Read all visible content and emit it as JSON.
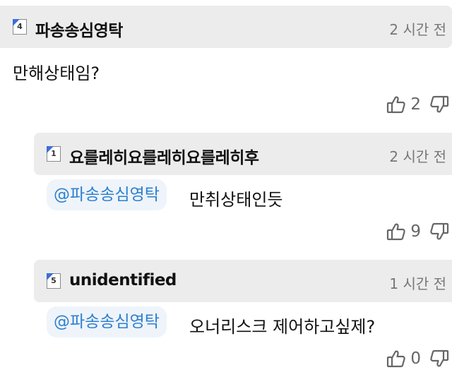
{
  "comments": [
    {
      "level": "4",
      "user": "파송송심영탁",
      "time": "2 시간 전",
      "mention": "",
      "text": "만해상태임?",
      "likes": "2"
    },
    {
      "level": "1",
      "user": "요를레히요를레히요를레히후",
      "time": "2 시간 전",
      "mention": "@파송송심영탁",
      "text": "만취상태인듯",
      "likes": "9"
    },
    {
      "level": "5",
      "user": "unidentified",
      "time": "1 시간 전",
      "mention": "@파송송심영탁",
      "text": "오너리스크 제어하고싶제?",
      "likes": "0"
    }
  ],
  "icons": {
    "like": "thumbs-up-icon",
    "dislike": "thumbs-down-icon",
    "level": "level-badge-icon"
  },
  "colors": {
    "header_bg": "#ececec",
    "mention_text": "#2d7fcf",
    "mention_bg": "#eef4fa",
    "time_text": "#777777"
  }
}
